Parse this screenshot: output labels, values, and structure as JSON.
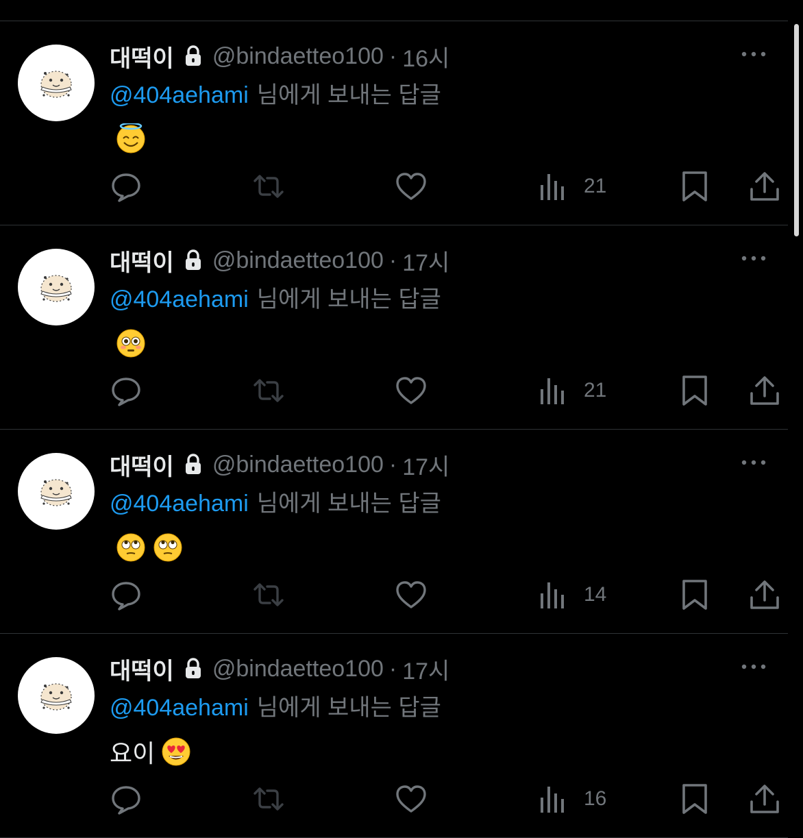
{
  "colors": {
    "background": "#000000",
    "text_primary": "#e7e9ea",
    "text_secondary": "#71767b",
    "mention": "#1d9bf0",
    "divider": "#2f3336"
  },
  "icons": {
    "lock": "lock-icon",
    "more": "more-dots-icon",
    "reply": "reply-bubble-icon",
    "retweet": "retweet-icon",
    "like": "heart-icon",
    "views": "views-bar-chart-icon",
    "bookmark": "bookmark-icon",
    "share": "share-upload-icon"
  },
  "tweets": [
    {
      "name": "대떡이",
      "handle": "@bindaetteo100",
      "separator": "·",
      "time": "16시",
      "mention": "@404aehami",
      "reply_text": "님에게 보내는 답글",
      "content_text": "",
      "content_emojis": [
        "smiling-face-with-halo"
      ],
      "views": "21"
    },
    {
      "name": "대떡이",
      "handle": "@bindaetteo100",
      "separator": "·",
      "time": "17시",
      "mention": "@404aehami",
      "reply_text": "님에게 보내는 답글",
      "content_text": "",
      "content_emojis": [
        "flushed-face"
      ],
      "views": "21"
    },
    {
      "name": "대떡이",
      "handle": "@bindaetteo100",
      "separator": "·",
      "time": "17시",
      "mention": "@404aehami",
      "reply_text": "님에게 보내는 답글",
      "content_text": "",
      "content_emojis": [
        "face-with-rolling-eyes",
        "face-with-rolling-eyes"
      ],
      "views": "14"
    },
    {
      "name": "대떡이",
      "handle": "@bindaetteo100",
      "separator": "·",
      "time": "17시",
      "mention": "@404aehami",
      "reply_text": "님에게 보내는 답글",
      "content_text": "요이",
      "content_emojis": [
        "smiling-face-with-heart-eyes"
      ],
      "views": "16"
    }
  ]
}
